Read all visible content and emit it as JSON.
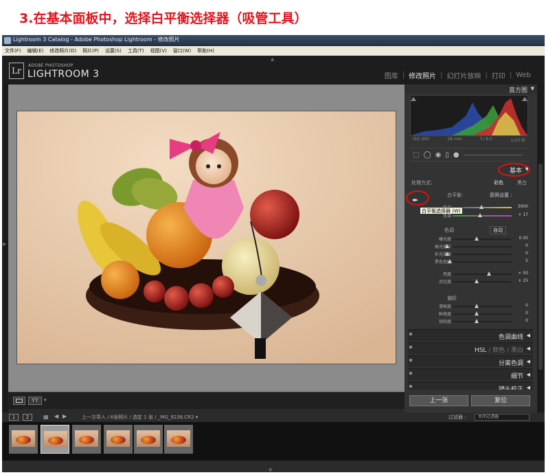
{
  "caption": "3.在基本面板中，选择白平衡选择器（吸管工具）",
  "titlebar": {
    "title": "Lightroom 3 Catalog - Adobe Photoshop Lightroom - 修改照片"
  },
  "menu": [
    "文件(F)",
    "编辑(E)",
    "修改照片(D)",
    "照片(P)",
    "设置(S)",
    "工具(T)",
    "视图(V)",
    "窗口(W)",
    "帮助(H)"
  ],
  "brand": {
    "badge": "Lr",
    "small": "ADOBE PHOTOSHOP",
    "big": "LIGHTROOM 3"
  },
  "modules": {
    "library": "图库",
    "develop": "修改照片",
    "slideshow": "幻灯片放映",
    "print": "打印",
    "web": "Web",
    "sep": "|"
  },
  "histogram": {
    "title": "直方图",
    "iso": "ISO 200",
    "focal": "28 mm",
    "aperture": "f / 8.0",
    "shutter": "1/10 秒"
  },
  "basic": {
    "title": "基本",
    "treatment_label": "处理方式:",
    "treatment_color": "彩色",
    "treatment_bw": "黑白",
    "wb_label": "白平衡:",
    "wb_value": "原照设置 :",
    "wb_tooltip": "白平衡选择器 (W)",
    "temp_label": "色温",
    "temp_value": "3900",
    "tint_label": "色调",
    "tint_value": "+ 17",
    "tone_label": "色调",
    "auto_label": "自动",
    "tone_rows": [
      {
        "label": "曝光度",
        "value": "0.00"
      },
      {
        "label": "高光修正",
        "value": "0"
      },
      {
        "label": "补光效果",
        "value": "0"
      },
      {
        "label": "黑色色阶",
        "value": "5"
      },
      {
        "label": "亮度",
        "value": "+ 50"
      },
      {
        "label": "对比度",
        "value": "+ 25"
      }
    ],
    "presence_label": "偏好",
    "presence_rows": [
      {
        "label": "清晰度",
        "value": "0"
      },
      {
        "label": "鲜艳度",
        "value": "0"
      },
      {
        "label": "饱和度",
        "value": "0"
      }
    ]
  },
  "panels": {
    "tone_curve": "色调曲线",
    "hsl": "HSL",
    "hsl_color": "颜色",
    "hsl_bw": "黑白",
    "split": "分离色调",
    "detail": "细节",
    "lens": "镜头校正"
  },
  "buttons": {
    "previous": "上一张",
    "reset": "复位"
  },
  "filmstrip": {
    "view1": "1",
    "view2": "2",
    "source": "上一次导入 / 6张照片 / 选定 1 张 / _MG_9238.CR2 ▾",
    "filter_label": "过滤器 :",
    "filter_value": "关闭过滤器"
  },
  "colors": {
    "caption_red": "#e0141b",
    "highlight_ring": "#e01010"
  }
}
